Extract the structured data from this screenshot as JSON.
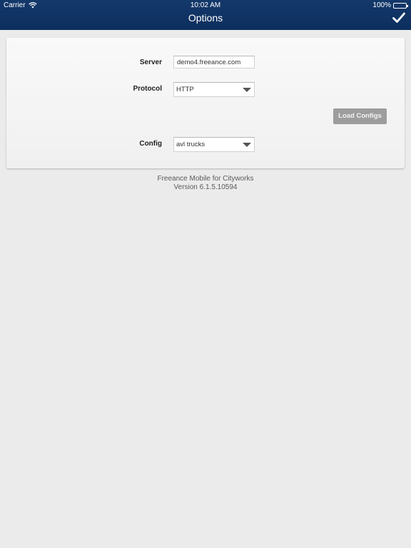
{
  "status_bar": {
    "carrier": "Carrier",
    "time": "10:02 AM",
    "battery": "100%"
  },
  "nav": {
    "title": "Options",
    "done_icon": "checkmark-icon"
  },
  "form": {
    "server": {
      "label": "Server",
      "value": "demo4.freeance.com"
    },
    "protocol": {
      "label": "Protocol",
      "value": "HTTP"
    },
    "load_configs_label": "Load Configs",
    "config": {
      "label": "Config",
      "value": "avl trucks"
    }
  },
  "footer": {
    "app_name": "Freeance Mobile for Cityworks",
    "version": "Version 6.1.5.10594"
  },
  "colors": {
    "nav_background": "#0f3265",
    "page_background": "#ebebeb",
    "button_background": "#9d9d9d"
  }
}
